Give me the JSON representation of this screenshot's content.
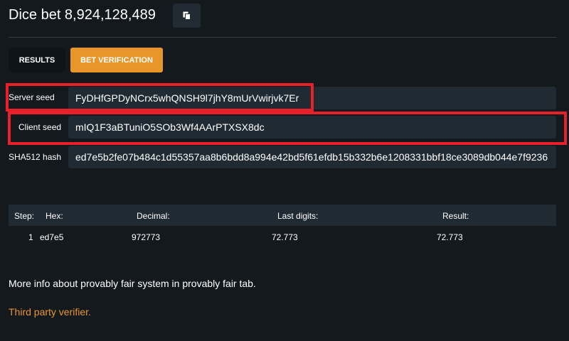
{
  "header": {
    "title": "Dice bet 8,924,128,489",
    "copy_icon": "copy-icon"
  },
  "tabs": [
    {
      "label": "RESULTS",
      "active": false
    },
    {
      "label": "BET VERIFICATION",
      "active": true
    }
  ],
  "fields": {
    "server_seed": {
      "label": "Server seed",
      "value": "FyDHfGPDyNCrx5whQNSH9l7jhY8mUrVwirjvk7Er"
    },
    "client_seed": {
      "label": "Client seed",
      "value": "mIQ1F3aBTuniO5SOb3Wf4AArPTXSX8dc"
    },
    "sha512": {
      "label": "SHA512 hash",
      "value": "ed7e5b2fe07b484c1d55357aa8b6bdd8a994e42bd5f61efdb15b332b6e1208331bbf18ce3089db044e7f9236"
    }
  },
  "table": {
    "headers": {
      "step": "Step:",
      "hex": "Hex:",
      "decimal": "Decimal:",
      "last_digits": "Last digits:",
      "result": "Result:"
    },
    "rows": [
      {
        "step": "1",
        "hex": "ed7e5",
        "decimal": "972773",
        "last_digits": "72.773",
        "result": "72.773"
      }
    ]
  },
  "footer": {
    "info": "More info about provably fair system in provably fair tab.",
    "link": "Third party verifier."
  },
  "colors": {
    "background": "#14191e",
    "accent": "#e8962a",
    "field": "#1f2a33",
    "highlight": "#e8202a"
  }
}
